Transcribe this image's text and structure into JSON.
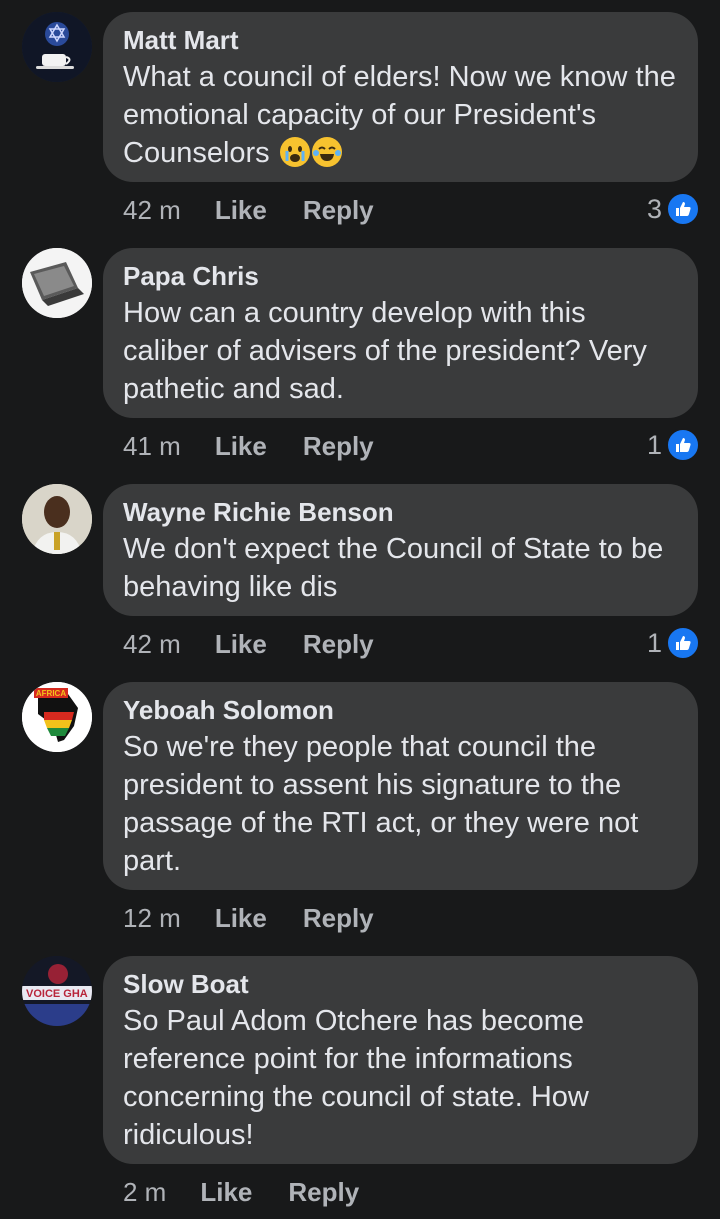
{
  "comments": [
    {
      "name": "Matt Mart",
      "text": "What a council of elders! Now we know the emotional capacity of our President's Counselors",
      "emojis": [
        "crying-face",
        "tears-of-joy"
      ],
      "time": "42 m",
      "like_label": "Like",
      "reply_label": "Reply",
      "reactions": "3"
    },
    {
      "name": "Papa Chris",
      "text": "How can a country develop with this caliber of advisers of the president? Very pathetic and sad.",
      "time": "41 m",
      "like_label": "Like",
      "reply_label": "Reply",
      "reactions": "1"
    },
    {
      "name": "Wayne Richie Benson",
      "text": "We don't expect the Council of State to be behaving like dis",
      "time": "42 m",
      "like_label": "Like",
      "reply_label": "Reply",
      "reactions": "1"
    },
    {
      "name": "Yeboah Solomon",
      "text": "So we're they people that council the president to assent his signature to the passage of the RTI act, or they were not part.",
      "time": "12 m",
      "like_label": "Like",
      "reply_label": "Reply",
      "avatar_text": "AFRICA"
    },
    {
      "name": "Slow Boat",
      "text": "So Paul Adom Otchere has become reference point for the informations concerning the council of state. How ridiculous!",
      "time": "2 m",
      "like_label": "Like",
      "reply_label": "Reply",
      "avatar_text": "VOICE GHA"
    }
  ],
  "colors": {
    "background": "#18191a",
    "bubble": "#3a3b3c",
    "name_text": "#e4e6eb",
    "meta_text": "#b0b3b8",
    "like_badge": "#1877f2"
  }
}
